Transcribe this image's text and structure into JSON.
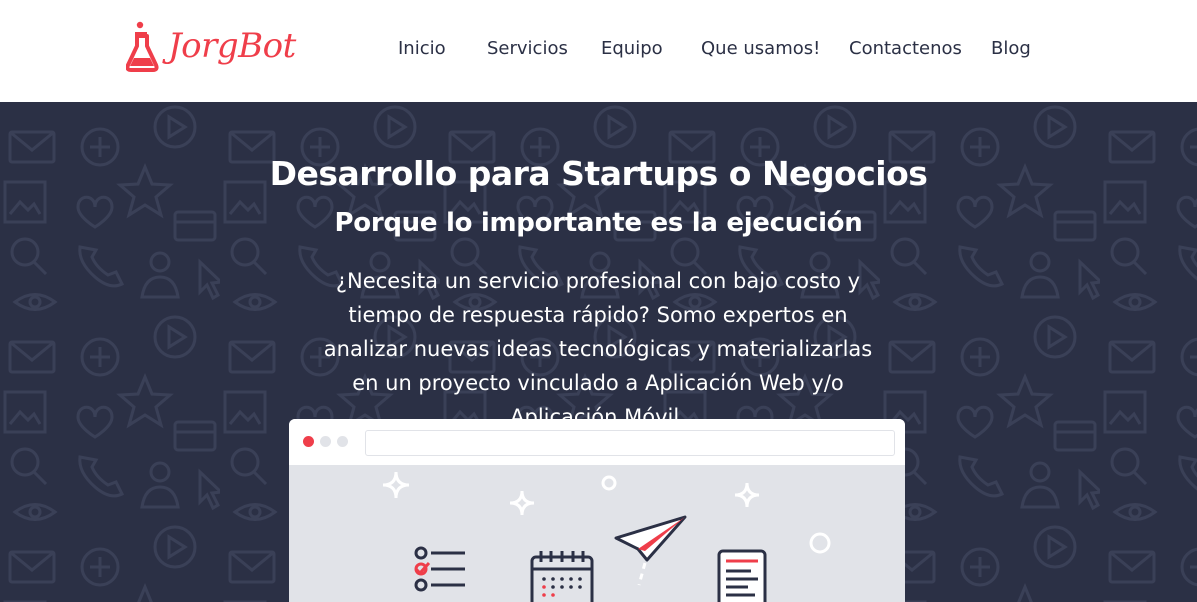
{
  "brand": {
    "name": "JorgBot",
    "color": "#ef3e4a"
  },
  "nav": {
    "items": [
      {
        "label": "Inicio"
      },
      {
        "label": "Servicios"
      },
      {
        "label": "Equipo"
      },
      {
        "label": "Que usamos!"
      },
      {
        "label": "Contactenos"
      },
      {
        "label": "Blog"
      }
    ]
  },
  "hero": {
    "title": "Desarrollo para Startups o Negocios",
    "subtitle": "Porque lo importante es la ejecución",
    "description": "¿Necesita un servicio profesional con bajo costo y tiempo de respuesta rápido? Somo expertos en analizar nuevas ideas tecnológicas y materializarlas en un proyecto vinculado a Aplicación Web y/o Aplicación Móvil.",
    "background_color": "#2b3045"
  },
  "browser_mock": {
    "icons": [
      "checklist-icon",
      "calendar-icon",
      "paper-plane-icon",
      "document-icon"
    ]
  }
}
